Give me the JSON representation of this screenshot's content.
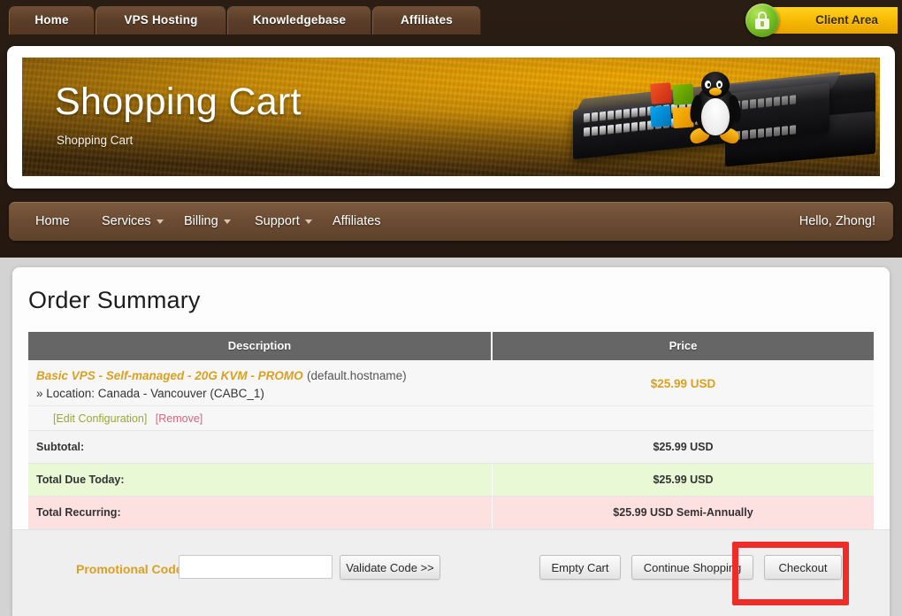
{
  "top_tabs": [
    {
      "label": "Home",
      "name": "tab-home"
    },
    {
      "label": "VPS Hosting",
      "name": "tab-vps-hosting"
    },
    {
      "label": "Knowledgebase",
      "name": "tab-knowledgebase"
    },
    {
      "label": "Affiliates",
      "name": "tab-affiliates"
    }
  ],
  "client_area": {
    "label": "Client Area",
    "icon": "padlock-icon"
  },
  "banner": {
    "title": "Shopping Cart",
    "subtitle": "Shopping Cart",
    "artwork": "network-switch-windows-linux-illustration"
  },
  "mainnav": {
    "items": [
      {
        "label": "Home",
        "caret": false
      },
      {
        "label": "Services",
        "caret": true
      },
      {
        "label": "Billing",
        "caret": true
      },
      {
        "label": "Support",
        "caret": true
      },
      {
        "label": "Affiliates",
        "caret": false
      }
    ],
    "user_menu": "Hello, Zhong!"
  },
  "main": {
    "page_title": "Order Summary",
    "table": {
      "headers": {
        "description": "Description",
        "price": "Price"
      },
      "product": {
        "name": "Basic VPS - Self-managed - 20G KVM - PROMO",
        "hostname": "(default.hostname)",
        "location": "» Location: Canada - Vancouver (CABC_1)",
        "price": "$25.99 USD",
        "edit_link": "[Edit Configuration]",
        "remove_link": "[Remove]"
      },
      "totals": [
        {
          "label": "Subtotal:",
          "value": "$25.99 USD",
          "style": "sub"
        },
        {
          "label": "Total Due Today:",
          "value": "$25.99 USD",
          "style": "today"
        },
        {
          "label": "Total Recurring:",
          "value": "$25.99 USD Semi-Annually",
          "style": "recur"
        }
      ]
    },
    "actions": {
      "promo_label": "Promotional Code",
      "promo_value": "",
      "promo_placeholder": "",
      "validate_button": "Validate Code >>",
      "empty_cart_button": "Empty Cart",
      "continue_shopping_button": "Continue Shopping",
      "checkout_button": "Checkout"
    }
  },
  "highlight": {
    "target": "checkout-button",
    "color": "#ef2d28"
  },
  "colors": {
    "accent_gold": "#d9a021",
    "header_brown": "#241a12",
    "nav_brown": "#6b4c33",
    "table_header_gray": "#666666",
    "row_green": "#e9f8d5",
    "row_pink": "#fde0e0",
    "client_area_yellow": "#f6b700"
  }
}
